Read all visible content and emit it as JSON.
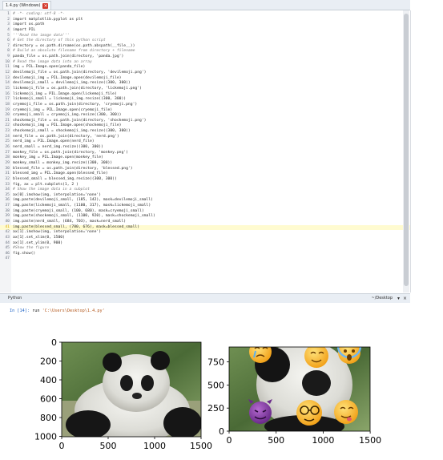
{
  "editor_tab": {
    "title": "1.4.py (Windows)"
  },
  "code_lines": [
    {
      "n": "1",
      "t": "# -*- coding: utf-8 -*-",
      "c": true
    },
    {
      "n": "2",
      "t": "import matplotlib.pyplot as plt",
      "c": false
    },
    {
      "n": "3",
      "t": "import os.path",
      "c": false
    },
    {
      "n": "4",
      "t": "import PIL",
      "c": false
    },
    {
      "n": "5",
      "t": "'''Read the image data'''",
      "c": true
    },
    {
      "n": "6",
      "t": "# Get the directory of this python script",
      "c": true
    },
    {
      "n": "7",
      "t": "directory = os.path.dirname(os.path.abspath(__file__))",
      "c": false
    },
    {
      "n": "8",
      "t": "# Build an absolute filename from directory + filename",
      "c": true
    },
    {
      "n": "9",
      "t": "panda_file = os.path.join(directory, 'panda.jpg')",
      "c": false
    },
    {
      "n": "10",
      "t": "# Read the image data into an array",
      "c": true
    },
    {
      "n": "11",
      "t": "img = PIL.Image.open(panda_file)",
      "c": false
    },
    {
      "n": "12",
      "t": "devilemoji_file = os.path.join(directory, 'devilemoji.png')",
      "c": false
    },
    {
      "n": "13",
      "t": "devilemoji_img = PIL.Image.open(devilemoji_file)",
      "c": false
    },
    {
      "n": "14",
      "t": "devilemoji_small = devilemoji_img.resize((300, 300))",
      "c": false
    },
    {
      "n": "15",
      "t": "lickemoji_file = os.path.join(directory, 'lickemoji.png')",
      "c": false
    },
    {
      "n": "16",
      "t": "lickemoji_img = PIL.Image.open(lickemoji_file)",
      "c": false
    },
    {
      "n": "17",
      "t": "lickemoji_small = lickemoji_img.resize((300, 300))",
      "c": false
    },
    {
      "n": "18",
      "t": "cryemoji_file = os.path.join(directory, 'cryemoji.png')",
      "c": false
    },
    {
      "n": "19",
      "t": "cryemoji_img = PIL.Image.open(cryemoji_file)",
      "c": false
    },
    {
      "n": "20",
      "t": "cryemoji_small = cryemoji_img.resize((300, 300))",
      "c": false
    },
    {
      "n": "21",
      "t": "shockemoji_file = os.path.join(directory, 'shockemoji.png')",
      "c": false
    },
    {
      "n": "22",
      "t": "shockemoji_img = PIL.Image.open(shockemoji_file)",
      "c": false
    },
    {
      "n": "23",
      "t": "shockemoji_small = shockemoji_img.resize((300, 300))",
      "c": false
    },
    {
      "n": "24",
      "t": "nerd_file = os.path.join(directory, 'nerd.png')",
      "c": false
    },
    {
      "n": "25",
      "t": "nerd_img = PIL.Image.open(nerd_file)",
      "c": false
    },
    {
      "n": "26",
      "t": "nerd_small = nerd_img.resize((300, 300))",
      "c": false
    },
    {
      "n": "27",
      "t": "monkey_file = os.path.join(directory, 'monkey.png')",
      "c": false
    },
    {
      "n": "28",
      "t": "monkey_img = PIL.Image.open(monkey_file)",
      "c": false
    },
    {
      "n": "29",
      "t": "monkey_small = monkey_img.resize((300, 300))",
      "c": false
    },
    {
      "n": "30",
      "t": "blessed_file = os.path.join(directory, 'blessed.png')",
      "c": false
    },
    {
      "n": "31",
      "t": "blessed_img = PIL.Image.open(blessed_file)",
      "c": false
    },
    {
      "n": "32",
      "t": "blessed_small = blessed_img.resize((300, 300))",
      "c": false
    },
    {
      "n": "33",
      "t": "fig, ax = plt.subplots(1, 2 )",
      "c": false
    },
    {
      "n": "34",
      "t": "# Show the image data in a subplot",
      "c": true
    },
    {
      "n": "35",
      "t": "ax[0].imshow(img, interpolation='none')",
      "c": false
    },
    {
      "n": "36",
      "t": "img.paste(devilemoji_small, (185, 142), mask=devilemoji_small)",
      "c": false
    },
    {
      "n": "37",
      "t": "img.paste(lickemoji_small, (1100, 317), mask=lickemoji_small)",
      "c": false
    },
    {
      "n": "38",
      "t": "img.paste(cryemoji_small, (100, 680), mask=cryemoji_small)",
      "c": false
    },
    {
      "n": "39",
      "t": "img.paste(shockemoji_small, (1100, 920), mask=shockemoji_small)",
      "c": false
    },
    {
      "n": "40",
      "t": "img.paste(nerd_small, (684, 703), mask=nerd_small)",
      "c": false
    },
    {
      "n": "41",
      "t": "img.paste(blessed_small, (780, 676), mask=blessed_small)",
      "c": false
    },
    {
      "n": "42",
      "t": "ax[1].imshow(img, interpolation='none')",
      "c": false
    },
    {
      "n": "43",
      "t": "ax[1].set_xlim(0, 1500)",
      "c": false
    },
    {
      "n": "44",
      "t": "ax[1].set_ylim(0, 900)",
      "c": false
    },
    {
      "n": "45",
      "t": "#Show the figure",
      "c": true
    },
    {
      "n": "46",
      "t": "fig.show()",
      "c": false
    },
    {
      "n": "47",
      "t": "",
      "c": false
    }
  ],
  "current_line": "41",
  "console": {
    "title": "Python",
    "location": "~/Desktop",
    "prompt": "In [14]:",
    "command": "run ",
    "command_path": "'C:\\Users\\Desktop\\1.4.py'"
  },
  "left_axes": {
    "xticks": [
      "0",
      "500",
      "1000",
      "1500"
    ],
    "yticks": [
      "0",
      "200",
      "400",
      "600",
      "800",
      "1000"
    ]
  },
  "right_axes": {
    "xticks": [
      "0",
      "500",
      "1000",
      "1500"
    ],
    "yticks": [
      "0",
      "250",
      "500",
      "750"
    ]
  },
  "emoji_icons": [
    "devil-emoji-icon",
    "lick-emoji-icon",
    "cry-emoji-icon",
    "shock-emoji-icon",
    "nerd-emoji-icon",
    "blessed-emoji-icon"
  ],
  "colors": {
    "console_prompt": "#1e63c6",
    "console_path": "#b3571b",
    "tab_close": "#d33a2c",
    "current_line": "#fffbd0"
  }
}
